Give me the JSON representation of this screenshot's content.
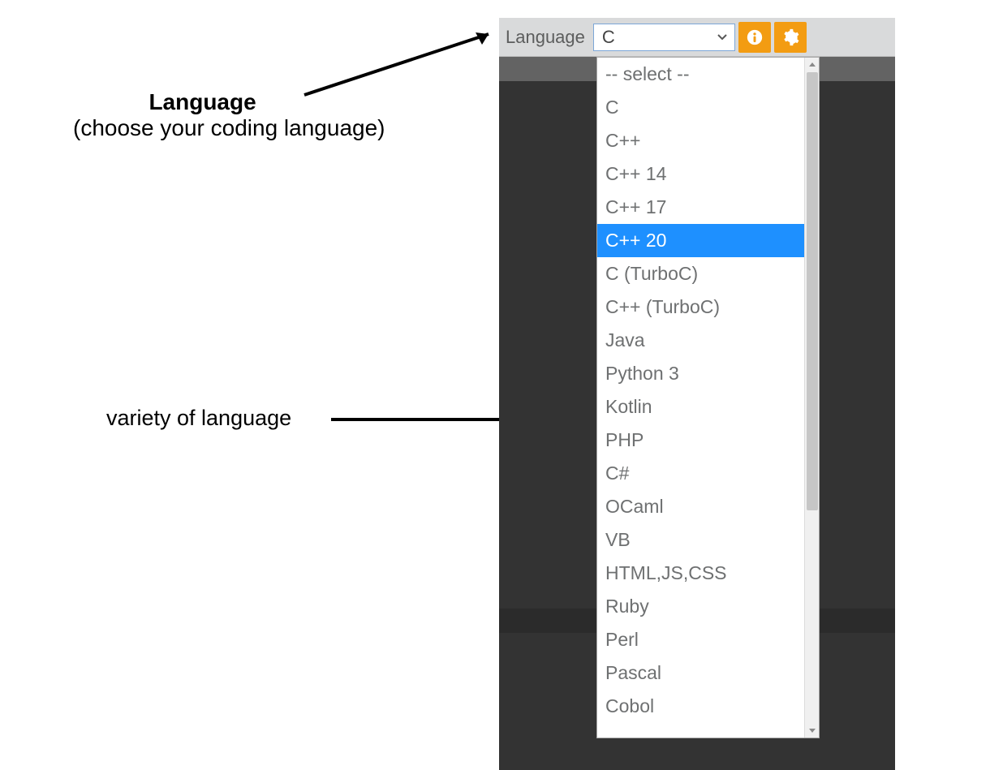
{
  "annotations": {
    "language_title": "Language",
    "language_sub": "(choose your coding language)",
    "variety": "variety of  language"
  },
  "toolbar": {
    "label": "Language",
    "selected": "C"
  },
  "dropdown": {
    "highlighted_index": 5,
    "items": [
      "-- select --",
      "C",
      "C++",
      "C++ 14",
      "C++ 17",
      "C++ 20",
      "C (TurboC)",
      "C++ (TurboC)",
      "Java",
      "Python 3",
      "Kotlin",
      "PHP",
      "C#",
      "OCaml",
      "VB",
      "HTML,JS,CSS",
      "Ruby",
      "Perl",
      "Pascal",
      "Cobol"
    ]
  },
  "colors": {
    "accent_orange": "#f39c12",
    "highlight_blue": "#1e90ff",
    "panel_dark": "#333333",
    "bracket_yellow": "#d4d400"
  }
}
